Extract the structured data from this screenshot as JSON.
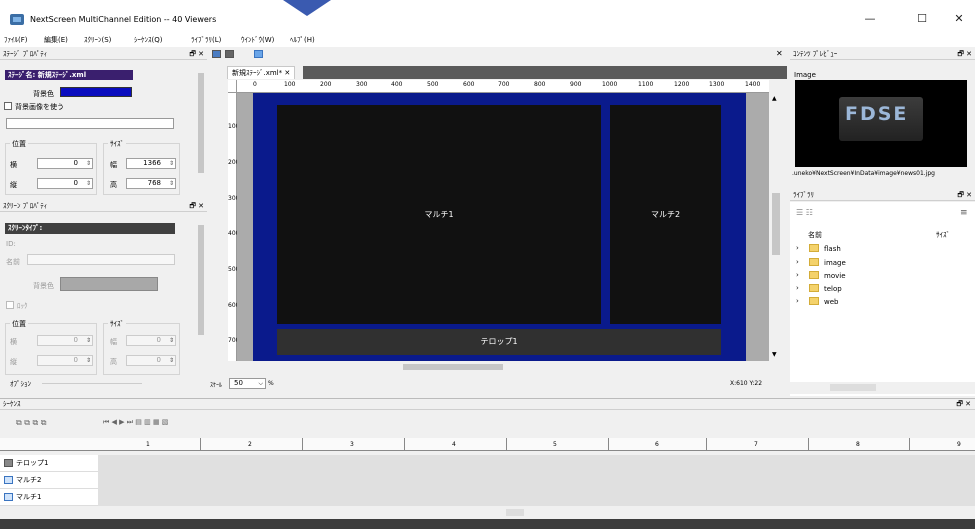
{
  "window": {
    "title": "NextScreen MultiChannel Edition -- 40 Viewers",
    "minimize": "—",
    "maximize": "☐",
    "close": "✕"
  },
  "menu": [
    "ﾌｧｲﾙ(F)",
    "編集(E)",
    "ｽｸﾘｰﾝ(S)",
    "ｼｰｹﾝｽ(Q)",
    "ﾗｲﾌﾞﾗﾘ(L)",
    "ｳｲﾝﾄﾞｳ(W)",
    "ﾍﾙﾌﾟ(H)"
  ],
  "stage_props": {
    "header": "ｽﾃｰｼﾞ ﾌﾟﾛﾊﾟﾃｨ",
    "name_label": "ｽﾃｰｼﾞ名: 新規ｽﾃｰｼﾞ.xml",
    "bgcolor_label": "背景色",
    "bgcolor": "#0a1a8c",
    "use_bg_image": "背景画像を使う",
    "position_label": "位置",
    "size_label": "ｻｲｽﾞ",
    "x_label": "横",
    "y_label": "縦",
    "w_label": "幅",
    "h_label": "高",
    "x": "0",
    "y": "0",
    "w": "1366",
    "h": "768"
  },
  "screen_props": {
    "header": "ｽｸﾘｰﾝ ﾌﾟﾛﾊﾟﾃｨ",
    "type_label": "ｽｸﾘｰﾝﾀｲﾌﾟ:",
    "id_label": "ID:",
    "name_label": "名前",
    "bgcolor_label": "背景色",
    "lock_label": "ﾛｯｸ",
    "position_label": "位置",
    "size_label": "ｻｲｽﾞ",
    "x_label": "横",
    "y_label": "縦",
    "w_label": "幅",
    "h_label": "高",
    "x": "0",
    "y": "0",
    "w": "0",
    "h": "0",
    "option_label": "ｵﾌﾟｼｮﾝ"
  },
  "editor": {
    "tab_label": "新規ｽﾃｰｼﾞ.xml*",
    "tab_close": "✕",
    "close": "✕",
    "ruler_h": [
      "0",
      "100",
      "200",
      "300",
      "400",
      "500",
      "600",
      "700",
      "800",
      "900",
      "1000",
      "1100",
      "1200",
      "1300",
      "1400"
    ],
    "ruler_v": [
      "100",
      "200",
      "300",
      "400",
      "500",
      "600",
      "700"
    ],
    "screens": {
      "multi1": "マルチ1",
      "multi2": "マルチ2",
      "telop1": "テロップ1"
    },
    "scale_label": "ｽｹｰﾙ",
    "scale_value": "50",
    "scale_unit": "%",
    "coord": "X:610   Y:22"
  },
  "preview": {
    "header": "ｺﾝﾃﾝﾂ ﾌﾟﾚﾋﾞｭｰ",
    "type": "Image",
    "logo": "FDSE",
    "path": ".uneko¥NextScreen¥InData¥image¥news01.jpg"
  },
  "library": {
    "header": "ﾗｲﾌﾞﾗﾘ",
    "col_name": "名前",
    "col_size": "ｻｲｽﾞ",
    "folders": [
      "flash",
      "image",
      "movie",
      "telop",
      "web"
    ]
  },
  "sequence": {
    "header": "ｼｰｹﾝｽ",
    "timeline": [
      "1",
      "2",
      "3",
      "4",
      "5",
      "6",
      "7",
      "8",
      "9"
    ],
    "rows": [
      "テロップ1",
      "マルチ2",
      "マルチ1"
    ]
  }
}
